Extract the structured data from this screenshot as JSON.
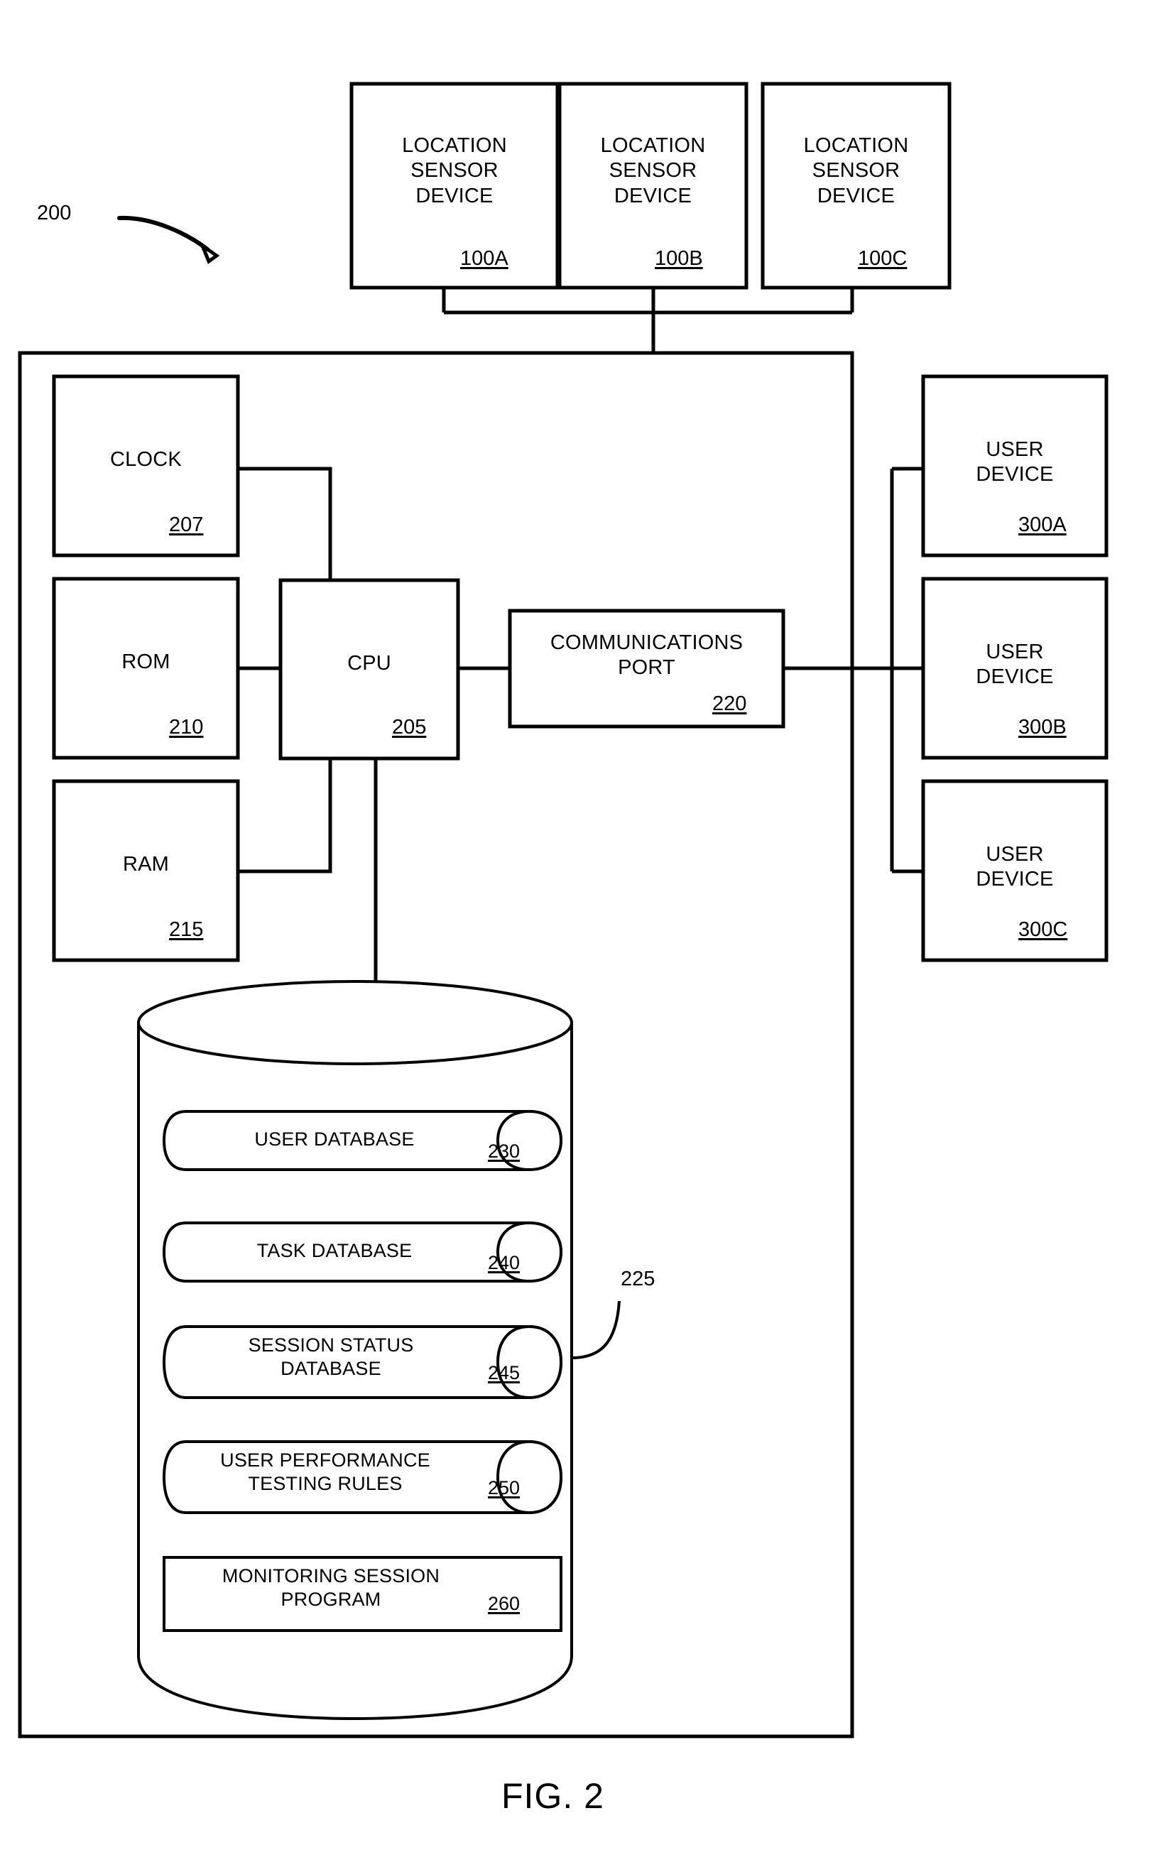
{
  "figure": {
    "caption": "FIG. 2",
    "system_ref": "200",
    "storage_ref": "225"
  },
  "sensors": [
    {
      "line1": "LOCATION",
      "line2": "SENSOR",
      "line3": "DEVICE",
      "ref": "100A"
    },
    {
      "line1": "LOCATION",
      "line2": "SENSOR",
      "line3": "DEVICE",
      "ref": "100B"
    },
    {
      "line1": "LOCATION",
      "line2": "SENSOR",
      "line3": "DEVICE",
      "ref": "100C"
    }
  ],
  "user_devices": [
    {
      "line1": "USER",
      "line2": "DEVICE",
      "ref": "300A"
    },
    {
      "line1": "USER",
      "line2": "DEVICE",
      "ref": "300B"
    },
    {
      "line1": "USER",
      "line2": "DEVICE",
      "ref": "300C"
    }
  ],
  "components": {
    "clock": {
      "label": "CLOCK",
      "ref": "207"
    },
    "rom": {
      "label": "ROM",
      "ref": "210"
    },
    "ram": {
      "label": "RAM",
      "ref": "215"
    },
    "cpu": {
      "label": "CPU",
      "ref": "205"
    },
    "comm_port": {
      "line1": "COMMUNICATIONS",
      "line2": "PORT",
      "ref": "220"
    }
  },
  "storage_items": [
    {
      "line1": "USER DATABASE",
      "line2": "",
      "ref": "230",
      "shape": "cylinder"
    },
    {
      "line1": "TASK DATABASE",
      "line2": "",
      "ref": "240",
      "shape": "cylinder"
    },
    {
      "line1": "SESSION STATUS",
      "line2": "DATABASE",
      "ref": "245",
      "shape": "cylinder"
    },
    {
      "line1": "USER PERFORMANCE",
      "line2": "TESTING RULES",
      "ref": "250",
      "shape": "cylinder"
    },
    {
      "line1": "MONITORING SESSION",
      "line2": "PROGRAM",
      "ref": "260",
      "shape": "rectangle"
    }
  ],
  "colors": {
    "ink": "#000000",
    "paper": "#ffffff"
  }
}
